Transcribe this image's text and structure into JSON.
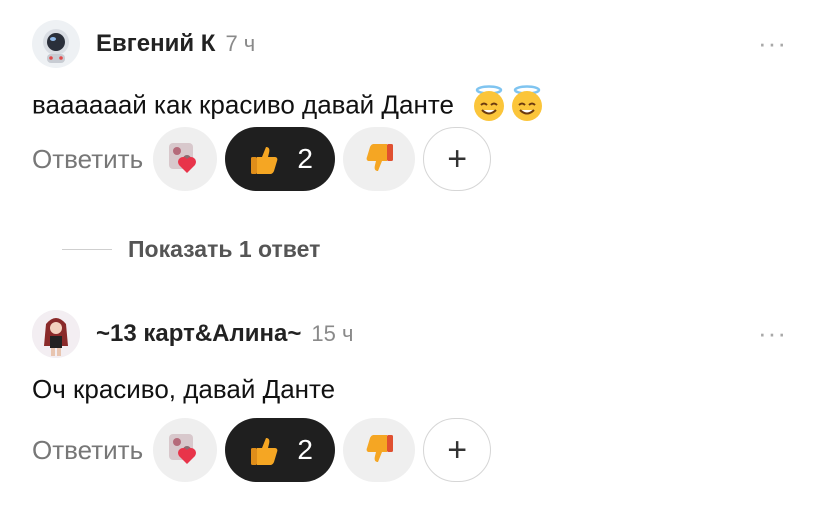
{
  "comments": [
    {
      "author": "Евгений К",
      "time": "7 ч",
      "more_icon": "···",
      "text": "ваааааай как красиво давай Данте",
      "reply_label": "Ответить",
      "like_count": "2",
      "plus_label": "+"
    },
    {
      "author": "~13 карт&Алина~",
      "time": "15 ч",
      "more_icon": "···",
      "text": "Оч красиво, давай Данте",
      "reply_label": "Ответить",
      "like_count": "2",
      "plus_label": "+"
    }
  ],
  "show_replies_label": "Показать 1 ответ",
  "icons": {
    "avatar_1": "astronaut-avatar-icon",
    "avatar_2": "girl-avatar-icon",
    "halo_emoji": "smiling-face-with-halo",
    "thumbs_up": "thumbs-up-icon",
    "thumbs_down": "thumbs-down-icon",
    "heart_sticker": "heart-sticker-icon"
  },
  "colors": {
    "like_pill": "#1f1f1f",
    "neutral_pill": "#efefef",
    "thumb": "#f5a623"
  }
}
